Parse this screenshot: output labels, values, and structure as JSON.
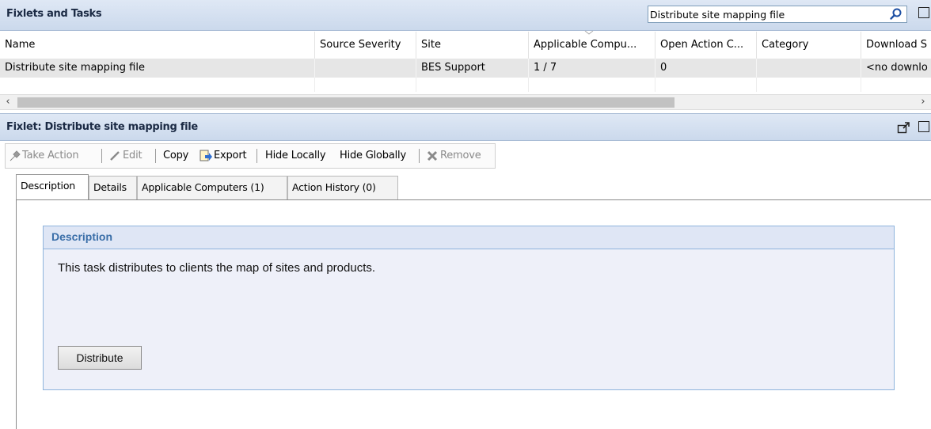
{
  "top_panel": {
    "title": "Fixlets and Tasks",
    "search_value": "Distribute site mapping file"
  },
  "table": {
    "columns": [
      "Name",
      "Source Severity",
      "Site",
      "Applicable Compu...",
      "Open Action C...",
      "Category",
      "Download S"
    ],
    "rows": [
      [
        "Distribute site mapping file",
        "",
        "BES Support",
        "1 / 7",
        "0",
        "",
        "<no downlo"
      ]
    ]
  },
  "fixlet_panel": {
    "title": "Fixlet: Distribute site mapping file"
  },
  "toolbar": {
    "take_action": "Take Action",
    "edit": "Edit",
    "copy": "Copy",
    "export": "Export",
    "hide_locally": "Hide Locally",
    "hide_globally": "Hide Globally",
    "remove": "Remove"
  },
  "tabs": [
    "Description",
    "Details",
    "Applicable Computers (1)",
    "Action History (0)"
  ],
  "description": {
    "header": "Description",
    "text": "This task distributes to clients the map of sites and products.",
    "button_label": "Distribute"
  },
  "colors": {
    "panel_header": "#cbd9ec",
    "desc_header_text": "#3a6ea8",
    "desc_background": "#eef0f9",
    "selected_row": "#e6e6e6"
  }
}
